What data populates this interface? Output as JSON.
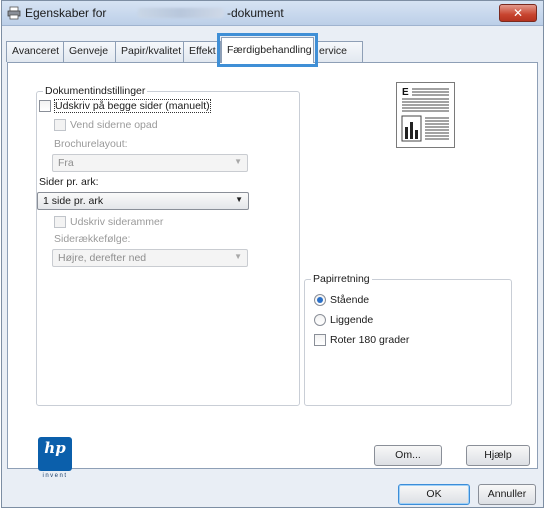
{
  "window": {
    "title_prefix": "Egenskaber for",
    "title_suffix": "-dokument",
    "close": "✕"
  },
  "tabs": [
    {
      "label": "Avanceret"
    },
    {
      "label": "Genveje"
    },
    {
      "label": "Papir/kvalitet"
    },
    {
      "label": "Effekt"
    },
    {
      "label": "Færdigbehandling",
      "active": true
    },
    {
      "label": "ervice"
    }
  ],
  "document_options": {
    "legend": "Dokumentindstillinger",
    "duplex_label": "Udskriv på begge sider (manuelt)",
    "flip_pages_label": "Vend siderne opad",
    "booklet_label": "Brochurelayout:",
    "booklet_value": "Fra",
    "pages_per_sheet_label": "Sider pr. ark:",
    "pages_per_sheet_value": "1 side pr. ark",
    "print_borders_label": "Udskriv siderammer",
    "page_order_label": "Siderækkefølge:",
    "page_order_value": "Højre, derefter ned"
  },
  "orientation": {
    "legend": "Papirretning",
    "portrait_label": "Stående",
    "portrait_selected": true,
    "landscape_label": "Liggende",
    "rotate_label": "Roter 180 grader"
  },
  "preview": {
    "letter": "E"
  },
  "logo": {
    "text": "hp",
    "tagline": "invent"
  },
  "buttons": {
    "about": "Om...",
    "help": "Hjælp",
    "ok": "OK",
    "cancel": "Annuller"
  },
  "colors": {
    "accent": "#3f8fd6",
    "logo": "#0b5fab",
    "close": "#c8442f"
  }
}
